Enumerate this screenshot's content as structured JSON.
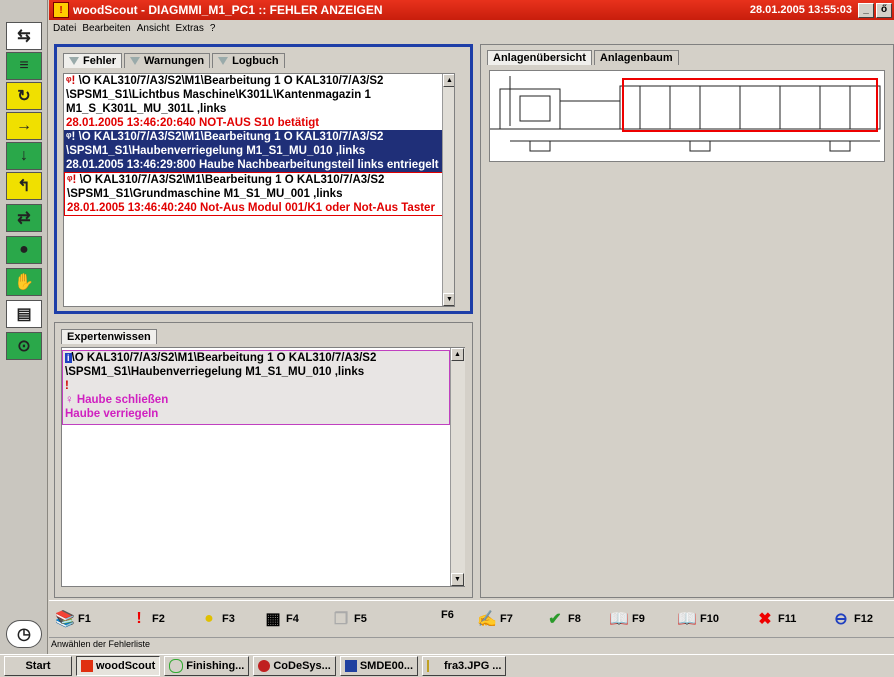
{
  "window": {
    "title": "woodScout - DIAGMMI_M1_PC1 :: FEHLER ANZEIGEN",
    "clock": "28.01.2005 13:55:03",
    "controls": [
      "_",
      "ő"
    ]
  },
  "menu": [
    "Datei",
    "Bearbeiten",
    "Ansicht",
    "Extras",
    "?"
  ],
  "error_panel": {
    "tabs": [
      "Fehler",
      "Warnungen",
      "Logbuch"
    ],
    "entries": [
      {
        "path": "\\O KAL310/7/A3/S2\\M1\\Bearbeitung 1 O KAL310/7/A3/S2 \\SPSM1_S1\\Lichtbus Maschine\\K301L\\Kantenmagazin 1 M1_S_K301L_MU_301L ,links",
        "message": "28.01.2005 13:46:20:640  NOT-AUS S10 betätigt"
      },
      {
        "path": "\\O KAL310/7/A3/S2\\M1\\Bearbeitung 1 O KAL310/7/A3/S2 \\SPSM1_S1\\Haubenverriegelung M1_S1_MU_010 ,links",
        "message": "28.01.2005 13:46:29:800  Haube Nachbearbeitungsteil links entriegelt"
      },
      {
        "path": "\\O KAL310/7/A3/S2\\M1\\Bearbeitung 1 O KAL310/7/A3/S2 \\SPSM1_S1\\Grundmaschine M1_S1_MU_001 ,links",
        "message": "28.01.2005 13:46:40:240  Not-Aus Modul 001/K1 oder Not-Aus Taster"
      }
    ]
  },
  "expert_panel": {
    "tab": "Expertenwissen",
    "path": "\\O KAL310/7/A3/S2\\M1\\Bearbeitung 1 O KAL310/7/A3/S2 \\SPSM1_S1\\Haubenverriegelung M1_S1_MU_010 ,links",
    "hint1": "Haube schließen",
    "hint2": "Haube verriegeln"
  },
  "right_panel": {
    "tabs": [
      "Anlagenübersicht",
      "Anlagenbaum"
    ]
  },
  "fkeys": [
    "F1",
    "F2",
    "F3",
    "F4",
    "F5",
    "F6",
    "F7",
    "F8",
    "F9",
    "F10",
    "F11",
    "F12"
  ],
  "status": "Anwählen der Fehlerliste",
  "taskbar": {
    "start": "Start",
    "items": [
      "woodScout",
      "Finishing...",
      "CoDeSys...",
      "SMDE00...",
      "fra3.JPG ..."
    ]
  },
  "colors": {
    "title": "#d82814",
    "selection": "#1f2f78",
    "error_text": "#e10000",
    "hint_text": "#d020c0",
    "panel_border": "#1e3ea8"
  }
}
